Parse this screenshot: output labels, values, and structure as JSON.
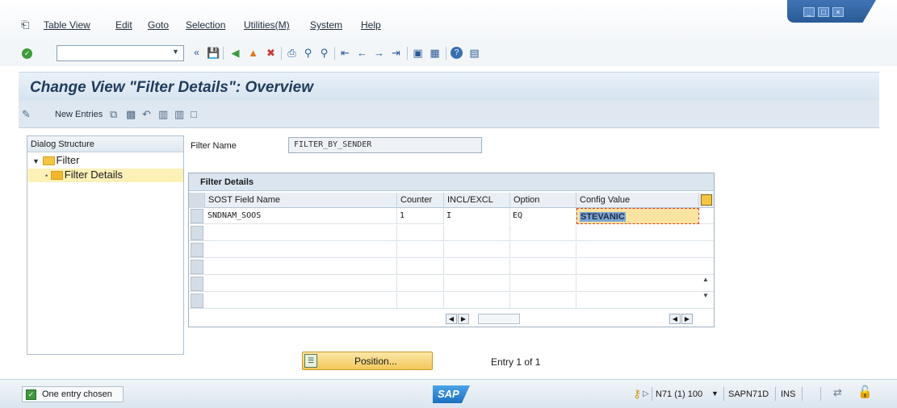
{
  "menu": {
    "items": [
      "Table View",
      "Edit",
      "Goto",
      "Selection",
      "Utilities(M)",
      "System",
      "Help"
    ]
  },
  "window_controls": {
    "minimize": "_",
    "maximize": "□",
    "close": "×"
  },
  "toolbar": {
    "command_field_value": "",
    "icons": [
      "back-icon",
      "save-icon",
      "back-nav-icon",
      "exit-icon",
      "cancel-icon",
      "print-icon",
      "find-icon",
      "find-next-icon",
      "first-page-icon",
      "prev-page-icon",
      "next-page-icon",
      "last-page-icon",
      "new-session-icon",
      "shortcut-icon",
      "help-icon",
      "customize-icon"
    ]
  },
  "title": "Change View \"Filter Details\": Overview",
  "app_toolbar": {
    "new_entries_label": "New Entries"
  },
  "dialog_structure": {
    "header": "Dialog Structure",
    "items": [
      {
        "label": "Filter",
        "level": 0,
        "expanded": true,
        "selected": false
      },
      {
        "label": "Filter Details",
        "level": 1,
        "expanded": false,
        "selected": true
      }
    ]
  },
  "filter_name": {
    "label": "Filter Name",
    "value": "FILTER_BY_SENDER"
  },
  "grid": {
    "title": "Filter Details",
    "columns": [
      "SOST Field Name",
      "Counter",
      "INCL/EXCL",
      "Option",
      "Config Value"
    ],
    "rows": [
      {
        "field": "SNDNAM_SOOS",
        "counter": "1",
        "incl": "I",
        "option": "EQ",
        "value": "STEVANIC"
      }
    ],
    "empty_rows": 5
  },
  "position_button": {
    "label": "Position..."
  },
  "entry_count": "Entry 1 of 1",
  "status": {
    "message": "One entry chosen",
    "logo": "SAP",
    "system": "N71 (1) 100",
    "program": "SAPN71D",
    "mode": "INS"
  },
  "colors": {
    "accent": "#2a5a98",
    "title_text": "#1f3b5c",
    "focus_cell": "#fbe3a1",
    "button_gold": "#f2c859",
    "ok_green": "#3d9a3d"
  }
}
